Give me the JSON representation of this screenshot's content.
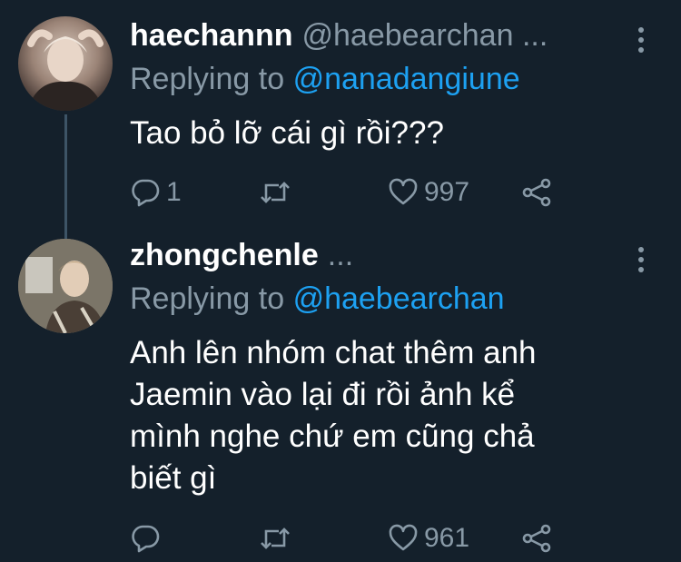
{
  "tweets": [
    {
      "name": "haechannn",
      "handle": "@haebearchan ...",
      "replying_prefix": "Replying to",
      "replying_to": "@nanadangiune",
      "text": "Tao bỏ lỡ cái gì rồi???",
      "reply_count": "1",
      "retweet_count": "",
      "like_count": "997"
    },
    {
      "name": "zhongchenle",
      "handle": "...",
      "replying_prefix": "Replying to",
      "replying_to": "@haebearchan",
      "text_lines": [
        "Anh lên nhóm chat thêm anh",
        "Jaemin vào lại đi rồi ảnh kể",
        "mình nghe chứ em cũng chả",
        "biết gì"
      ],
      "reply_count": "",
      "retweet_count": "",
      "like_count": "961"
    }
  ],
  "colors": {
    "background": "#14202b",
    "secondary_text": "#8899a6",
    "mention": "#1da1f2",
    "thread_line": "#3d5466"
  },
  "icons": [
    "reply-icon",
    "retweet-icon",
    "heart-icon",
    "share-icon",
    "more-options-icon"
  ]
}
